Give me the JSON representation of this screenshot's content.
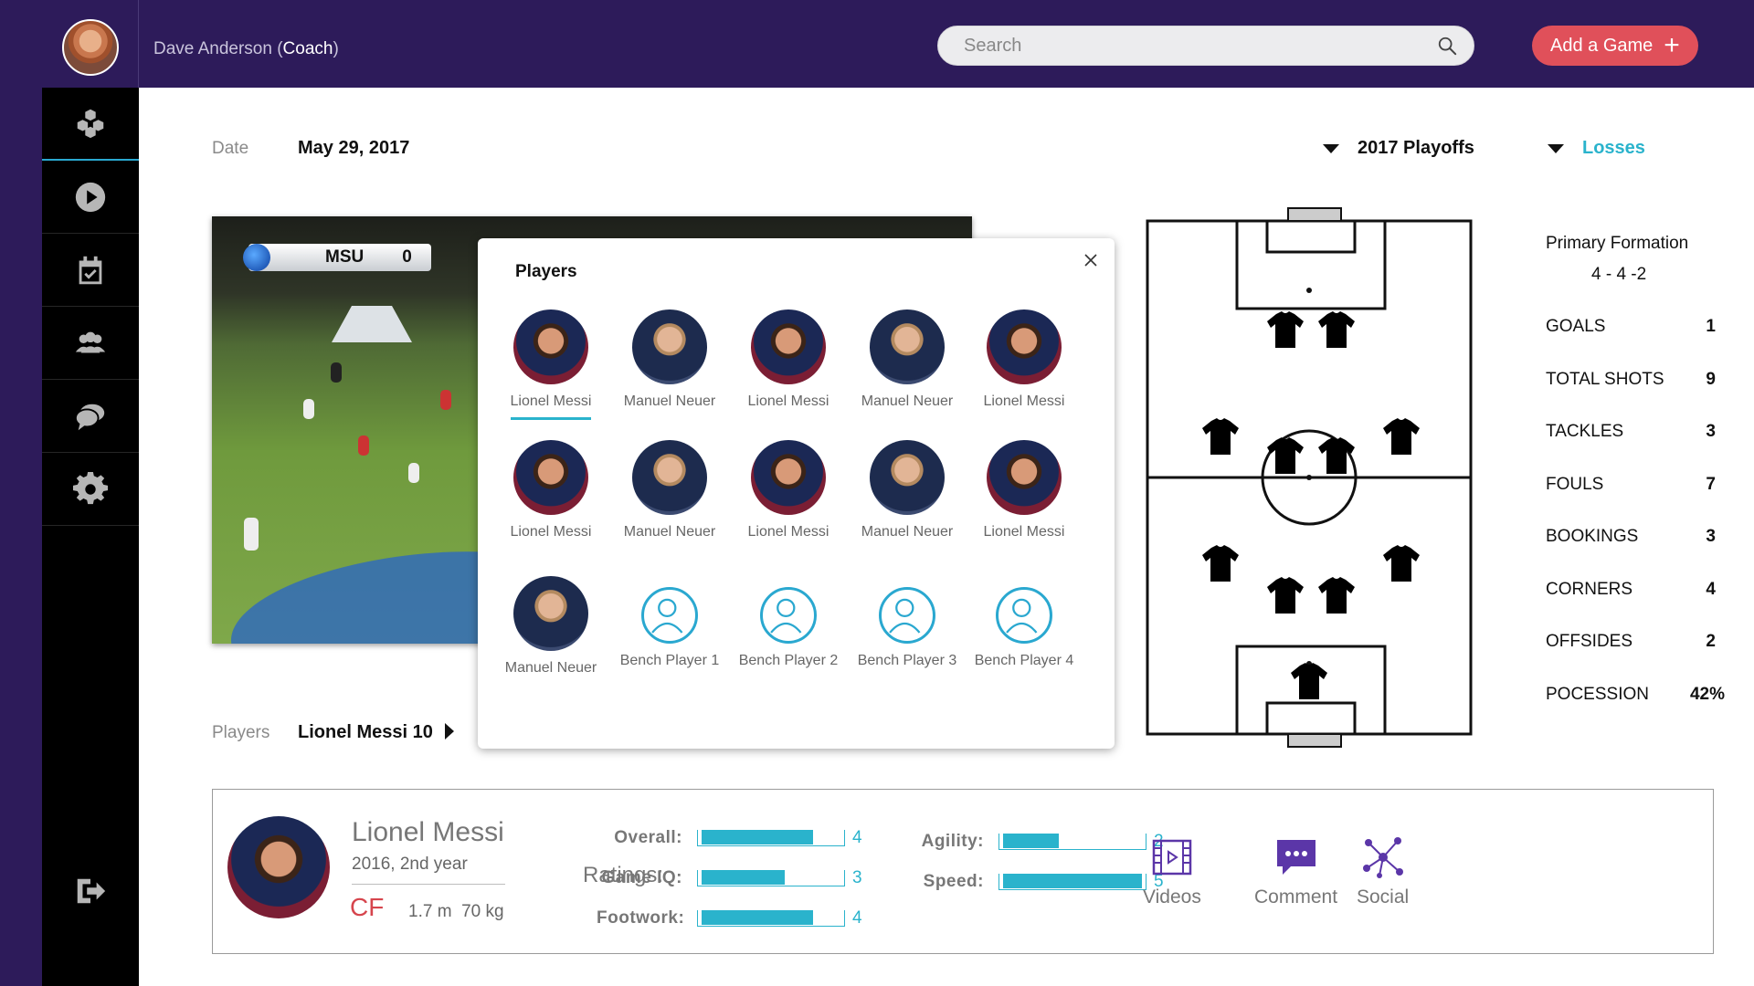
{
  "header": {
    "user_name": "Dave Anderson",
    "user_role_open": " (",
    "user_role": "Coach",
    "user_role_close": ")",
    "search_placeholder": "Search",
    "add_game_label": "Add a Game"
  },
  "sidebar": {
    "items": [
      {
        "icon": "blocks-icon",
        "active": true
      },
      {
        "icon": "play-icon",
        "active": false
      },
      {
        "icon": "calendar-check-icon",
        "active": false
      },
      {
        "icon": "team-icon",
        "active": false
      },
      {
        "icon": "chat-icon",
        "active": false
      },
      {
        "icon": "gear-icon",
        "active": false
      }
    ],
    "bottom_icon": "logout-icon"
  },
  "filters": {
    "date_label": "Date",
    "date_value": "May 29, 2017",
    "season": "2017 Playoffs",
    "result": "Losses",
    "players_label": "Players",
    "players_value": "Lionel Messi 10"
  },
  "video": {
    "team": "MSU",
    "score": "0"
  },
  "popup": {
    "title": "Players",
    "players": [
      {
        "name": "Lionel Messi",
        "type": "messi",
        "selected": true
      },
      {
        "name": "Manuel Neuer",
        "type": "neuer"
      },
      {
        "name": "Lionel Messi",
        "type": "messi"
      },
      {
        "name": "Manuel Neuer",
        "type": "neuer"
      },
      {
        "name": "Lionel Messi",
        "type": "messi"
      },
      {
        "name": "Lionel Messi",
        "type": "messi"
      },
      {
        "name": "Manuel Neuer",
        "type": "neuer"
      },
      {
        "name": "Lionel Messi",
        "type": "messi"
      },
      {
        "name": "Manuel Neuer",
        "type": "neuer"
      },
      {
        "name": "Lionel Messi",
        "type": "messi"
      },
      {
        "name": "Manuel Neuer",
        "type": "neuer"
      },
      {
        "name": "Bench Player 1",
        "type": "bench"
      },
      {
        "name": "Bench Player 2",
        "type": "bench"
      },
      {
        "name": "Bench Player 3",
        "type": "bench"
      },
      {
        "name": "Bench Player 4",
        "type": "bench"
      }
    ]
  },
  "stats": {
    "formation_label": "Primary Formation",
    "formation_value": "4 - 4 -2",
    "rows": [
      {
        "label": "GOALS",
        "value": "1"
      },
      {
        "label": "TOTAL SHOTS",
        "value": "9"
      },
      {
        "label": "TACKLES",
        "value": "3"
      },
      {
        "label": "FOULS",
        "value": "7"
      },
      {
        "label": "BOOKINGS",
        "value": "3"
      },
      {
        "label": "CORNERS",
        "value": "4"
      },
      {
        "label": "OFFSIDES",
        "value": "2"
      },
      {
        "label": "POCESSION",
        "value": "42%"
      }
    ]
  },
  "player_card": {
    "name": "Lionel Messi",
    "year": "2016, 2nd year",
    "position": "CF",
    "height": "1.7 m",
    "weight": "70 kg",
    "ratings_label": "Ratings:",
    "rating_max": 5,
    "ratings": [
      {
        "label": "Overall",
        "value": 4
      },
      {
        "label": "Game IQ",
        "value": 3
      },
      {
        "label": "Footwork",
        "value": 4
      },
      {
        "label": "Agility",
        "value": 2
      },
      {
        "label": "Speed",
        "value": 5
      }
    ],
    "actions": [
      {
        "label": "Videos",
        "icon": "film-icon"
      },
      {
        "label": "Comment",
        "icon": "comment-icon"
      },
      {
        "label": "Social",
        "icon": "network-icon"
      }
    ]
  },
  "colors": {
    "header_bg": "#2d1b5a",
    "accent": "#2ab3cc",
    "add_button": "#e0505a",
    "action_icons": "#5b36a8"
  }
}
